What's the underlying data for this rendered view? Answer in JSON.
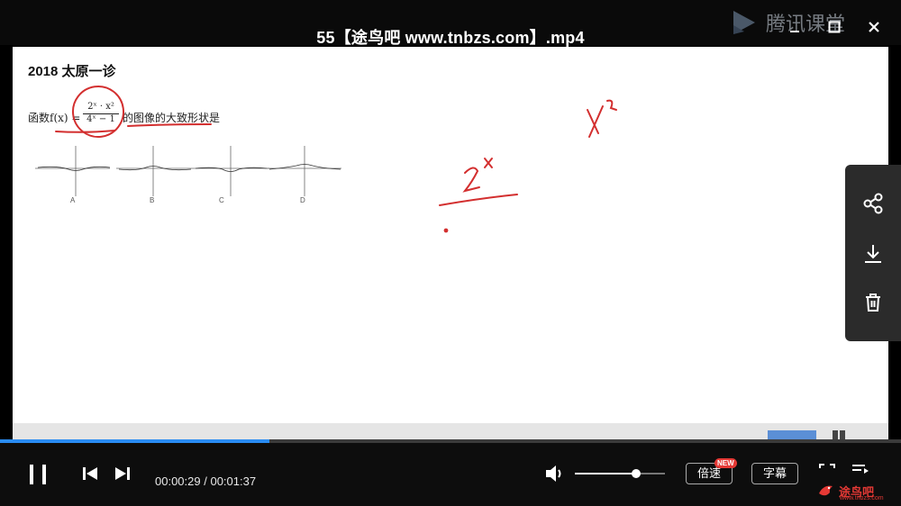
{
  "window": {
    "title": "55【途鸟吧 www.tnbzs.com】.mp4",
    "brand": "腾讯课堂"
  },
  "problem": {
    "heading": "2018 太原一诊",
    "prefix": "函数f(x) =",
    "numerator": "2ˣ · x²",
    "denominator": "4ˣ − 1",
    "suffix": "的图像的大致形状是",
    "options": [
      "A",
      "B",
      "C",
      "D"
    ]
  },
  "player": {
    "current_time": "00:00:29",
    "total_time": "00:01:37",
    "progress": 0.299,
    "volume": 0.68,
    "speed_label": "倍速",
    "speed_badge": "NEW",
    "subtitle_label": "字幕"
  },
  "watermark": {
    "text": "途鸟吧",
    "url": "www.tnbzs.com"
  },
  "colors": {
    "progress": "#2a8cf2",
    "ink": "#d32f2f",
    "badge": "#e53935"
  }
}
